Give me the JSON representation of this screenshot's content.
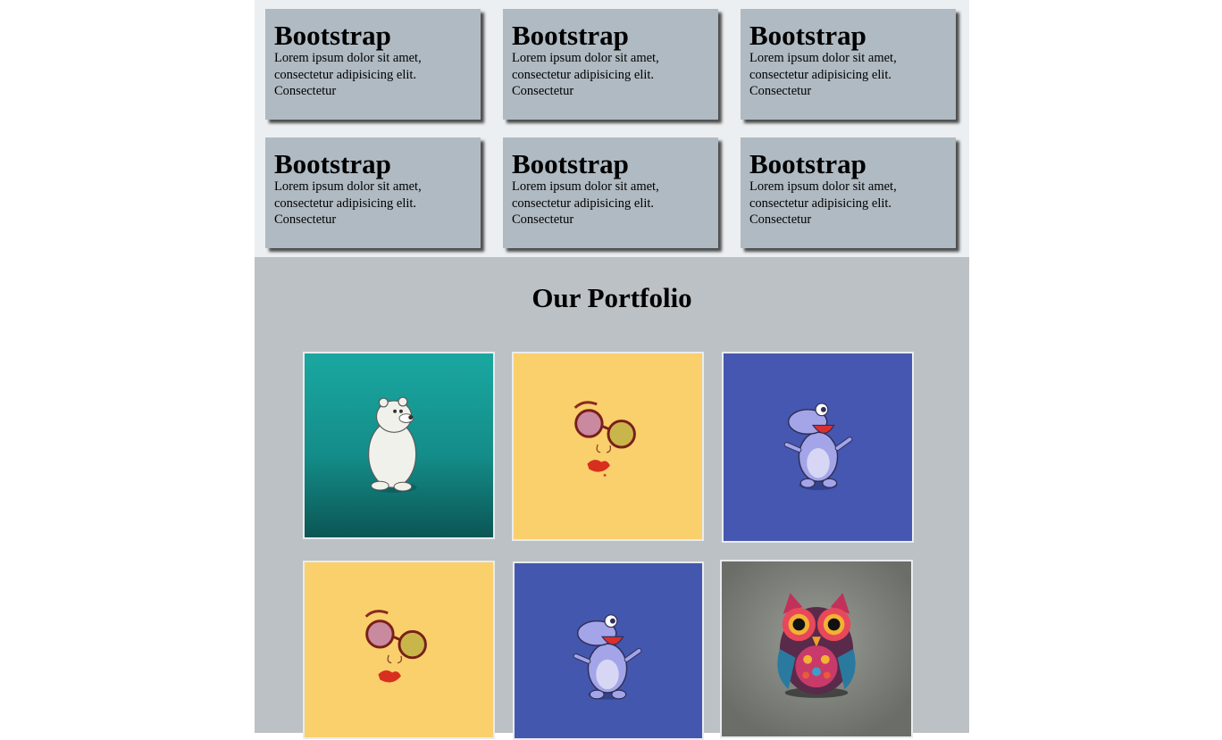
{
  "cards": [
    {
      "title": "Bootstrap",
      "text": "Lorem ipsum dolor sit amet, consectetur adipisicing elit. Consectetur"
    },
    {
      "title": "Bootstrap",
      "text": "Lorem ipsum dolor sit amet, consectetur adipisicing elit. Consectetur"
    },
    {
      "title": "Bootstrap",
      "text": "Lorem ipsum dolor sit amet, consectetur adipisicing elit. Consectetur"
    },
    {
      "title": "Bootstrap",
      "text": "Lorem ipsum dolor sit amet, consectetur adipisicing elit. Consectetur"
    },
    {
      "title": "Bootstrap",
      "text": "Lorem ipsum dolor sit amet, consectetur adipisicing elit. Consectetur"
    },
    {
      "title": "Bootstrap",
      "text": "Lorem ipsum dolor sit amet, consectetur adipisicing elit. Consectetur"
    }
  ],
  "portfolio": {
    "title": "Our Portfolio",
    "items": [
      {
        "image": "polar-bear-illustration",
        "bg": "#1a9e98"
      },
      {
        "image": "glasses-face-illustration",
        "bg": "#f9d06c"
      },
      {
        "image": "blue-hippo-illustration",
        "bg": "#4457b0"
      },
      {
        "image": "glasses-face-illustration",
        "bg": "#f9d06c"
      },
      {
        "image": "blue-hippo-illustration",
        "bg": "#4457b0"
      },
      {
        "image": "colorful-owl-illustration",
        "bg": "#7b7d78"
      }
    ]
  },
  "colors": {
    "card_bg": "#b0bac2",
    "page_bg": "#eceff1",
    "portfolio_bg": "#bcc1c6"
  }
}
